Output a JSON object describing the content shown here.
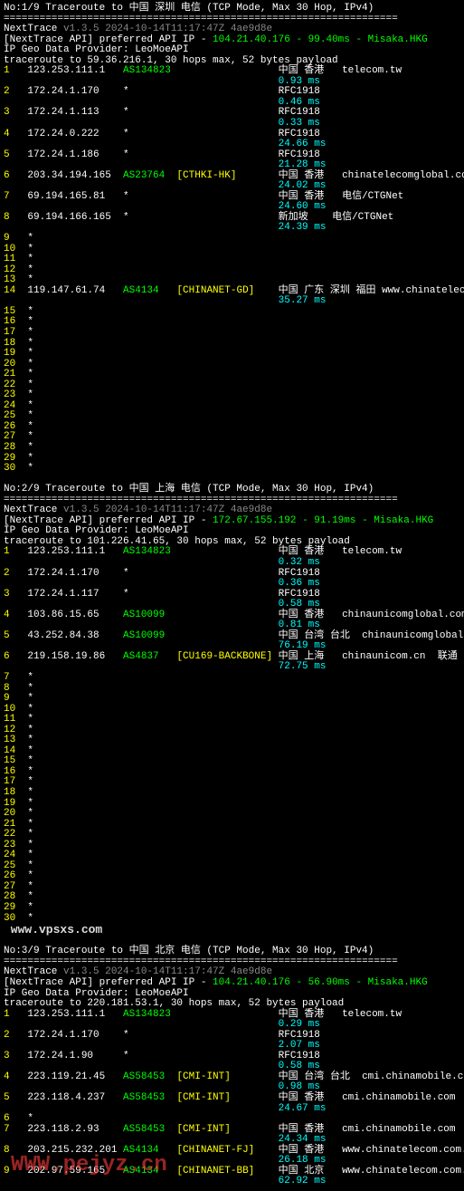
{
  "blocks": [
    {
      "header": "No:1/9 Traceroute to 中国 深圳 电信 (TCP Mode, Max 30 Hop, IPv4)",
      "sep": "==================================================================",
      "ntline": {
        "prefix": "NextTrace ",
        "ver": "v1.3.5 2024-10-14T11:17:47Z 4ae9d8e"
      },
      "apiline": {
        "prefix": "[NextTrace API] preferred API IP - ",
        "ip": "104.21.40.176 - 99.40ms - Misaka.HKG"
      },
      "provider": "IP Geo Data Provider: LeoMoeAPI",
      "traceroute": "traceroute to 59.36.216.1, 30 hops max, 52 bytes payload",
      "hops": [
        {
          "n": "1",
          "ip": "123.253.111.1",
          "as": "AS134823",
          "tag": "",
          "loc": "中国 香港   telecom.tw",
          "ms": "0.93 ms"
        },
        {
          "n": "2",
          "ip": "172.24.1.170",
          "star": "*",
          "loc": "RFC1918",
          "ms": "0.46 ms"
        },
        {
          "n": "3",
          "ip": "172.24.1.113",
          "star": "*",
          "loc": "RFC1918",
          "ms": "0.33 ms"
        },
        {
          "n": "4",
          "ip": "172.24.0.222",
          "star": "*",
          "loc": "RFC1918",
          "ms": "24.66 ms"
        },
        {
          "n": "5",
          "ip": "172.24.1.186",
          "star": "*",
          "loc": "RFC1918",
          "ms": "21.28 ms"
        },
        {
          "n": "6",
          "ip": "203.34.194.165",
          "as": "AS23764",
          "tag": "[CTHKI-HK]",
          "loc": "中国 香港   chinatelecomglobal.com  电信",
          "ms": "24.02 ms"
        },
        {
          "n": "7",
          "ip": "69.194.165.81",
          "star": "*",
          "loc": "中国 香港   电信/CTGNet",
          "ms": "24.60 ms"
        },
        {
          "n": "8",
          "ip": "69.194.166.165",
          "star": "*",
          "loc": "新加坡    电信/CTGNet",
          "ms": "24.39 ms"
        },
        {
          "n": "9",
          "star": "*"
        },
        {
          "n": "10",
          "star": "*"
        },
        {
          "n": "11",
          "star": "*"
        },
        {
          "n": "12",
          "star": "*"
        },
        {
          "n": "13",
          "star": "*"
        },
        {
          "n": "14",
          "ip": "119.147.61.74",
          "as": "AS4134",
          "tag": "[CHINANET-GD]",
          "loc": "中国 广东 深圳 福田 www.chinatelecom.com.cn  电信",
          "ms": "35.27 ms"
        },
        {
          "n": "15",
          "star": "*"
        },
        {
          "n": "16",
          "star": "*"
        },
        {
          "n": "17",
          "star": "*"
        },
        {
          "n": "18",
          "star": "*"
        },
        {
          "n": "19",
          "star": "*"
        },
        {
          "n": "20",
          "star": "*"
        },
        {
          "n": "21",
          "star": "*"
        },
        {
          "n": "22",
          "star": "*"
        },
        {
          "n": "23",
          "star": "*"
        },
        {
          "n": "24",
          "star": "*"
        },
        {
          "n": "25",
          "star": "*"
        },
        {
          "n": "26",
          "star": "*"
        },
        {
          "n": "27",
          "star": "*"
        },
        {
          "n": "28",
          "star": "*"
        },
        {
          "n": "29",
          "star": "*"
        },
        {
          "n": "30",
          "star": "*"
        }
      ]
    },
    {
      "header": "No:2/9 Traceroute to 中国 上海 电信 (TCP Mode, Max 30 Hop, IPv4)",
      "sep": "==================================================================",
      "ntline": {
        "prefix": "NextTrace ",
        "ver": "v1.3.5 2024-10-14T11:17:47Z 4ae9d8e"
      },
      "apiline": {
        "prefix": "[NextTrace API] preferred API IP - ",
        "ip": "172.67.155.192 - 91.19ms - Misaka.HKG"
      },
      "provider": "IP Geo Data Provider: LeoMoeAPI",
      "traceroute": "traceroute to 101.226.41.65, 30 hops max, 52 bytes payload",
      "hops": [
        {
          "n": "1",
          "ip": "123.253.111.1",
          "as": "AS134823",
          "tag": "",
          "loc": "中国 香港   telecom.tw",
          "ms": "0.32 ms"
        },
        {
          "n": "2",
          "ip": "172.24.1.170",
          "star": "*",
          "loc": "RFC1918",
          "ms": "0.36 ms"
        },
        {
          "n": "3",
          "ip": "172.24.1.117",
          "star": "*",
          "loc": "RFC1918",
          "ms": "0.58 ms"
        },
        {
          "n": "4",
          "ip": "103.86.15.65",
          "as": "AS10099",
          "tag": "",
          "loc": "中国 香港   chinaunicomglobal.com",
          "ms": "0.81 ms"
        },
        {
          "n": "5",
          "ip": "43.252.84.38",
          "as": "AS10099",
          "tag": "",
          "loc": "中国 台湾 台北  chinaunicomglobal.com",
          "ms": "76.19 ms"
        },
        {
          "n": "6",
          "ip": "219.158.19.86",
          "as": "AS4837",
          "tag": "[CU169-BACKBONE]",
          "loc": "中国 上海   chinaunicom.cn  联通",
          "ms": "72.75 ms"
        },
        {
          "n": "7",
          "star": "*"
        },
        {
          "n": "8",
          "star": "*"
        },
        {
          "n": "9",
          "star": "*"
        },
        {
          "n": "10",
          "star": "*"
        },
        {
          "n": "11",
          "star": "*"
        },
        {
          "n": "12",
          "star": "*"
        },
        {
          "n": "13",
          "star": "*"
        },
        {
          "n": "14",
          "star": "*"
        },
        {
          "n": "15",
          "star": "*"
        },
        {
          "n": "16",
          "star": "*"
        },
        {
          "n": "17",
          "star": "*"
        },
        {
          "n": "18",
          "star": "*"
        },
        {
          "n": "19",
          "star": "*"
        },
        {
          "n": "20",
          "star": "*"
        },
        {
          "n": "21",
          "star": "*"
        },
        {
          "n": "22",
          "star": "*"
        },
        {
          "n": "23",
          "star": "*"
        },
        {
          "n": "24",
          "star": "*"
        },
        {
          "n": "25",
          "star": "*"
        },
        {
          "n": "26",
          "star": "*"
        },
        {
          "n": "27",
          "star": "*"
        },
        {
          "n": "28",
          "star": "*"
        },
        {
          "n": "29",
          "star": "*"
        },
        {
          "n": "30",
          "star": "*"
        }
      ],
      "footer_wm": " www.vpsxs.com"
    },
    {
      "header": "No:3/9 Traceroute to 中国 北京 电信 (TCP Mode, Max 30 Hop, IPv4)",
      "sep": "==================================================================",
      "ntline": {
        "prefix": "NextTrace ",
        "ver": "v1.3.5 2024-10-14T11:17:47Z 4ae9d8e"
      },
      "apiline": {
        "prefix": "[NextTrace API] preferred API IP - ",
        "ip": "104.21.40.176 - 56.90ms - Misaka.HKG"
      },
      "provider": "IP Geo Data Provider: LeoMoeAPI",
      "traceroute": "traceroute to 220.181.53.1, 30 hops max, 52 bytes payload",
      "hops": [
        {
          "n": "1",
          "ip": "123.253.111.1",
          "as": "AS134823",
          "tag": "",
          "loc": "中国 香港   telecom.tw",
          "ms": "0.29 ms"
        },
        {
          "n": "2",
          "ip": "172.24.1.170",
          "star": "*",
          "loc": "RFC1918",
          "ms": "2.07 ms"
        },
        {
          "n": "3",
          "ip": "172.24.1.90",
          "star": "*",
          "loc": "RFC1918",
          "ms": "0.58 ms"
        },
        {
          "n": "4",
          "ip": "223.119.21.45",
          "as": "AS58453",
          "tag": "[CMI-INT]",
          "loc": "中国 台湾 台北  cmi.chinamobile.com",
          "ms": "0.98 ms"
        },
        {
          "n": "5",
          "ip": "223.118.4.237",
          "as": "AS58453",
          "tag": "[CMI-INT]",
          "loc": "中国 香港   cmi.chinamobile.com  移动",
          "ms": "24.67 ms"
        },
        {
          "n": "6",
          "star": "*"
        },
        {
          "n": "7",
          "ip": "223.118.2.93",
          "as": "AS58453",
          "tag": "[CMI-INT]",
          "loc": "中国 香港   cmi.chinamobile.com  移动",
          "ms": "24.34 ms"
        },
        {
          "n": "8",
          "ip": "203.215.232.201",
          "as": "AS4134",
          "tag": "[CHINANET-FJ]",
          "loc": "中国 香港   www.chinatelecom.com.cn  电信",
          "ms": "26.18 ms"
        },
        {
          "n": "9",
          "ip": "202.97.59.165",
          "as": "AS4134",
          "tag": "[CHINANET-BB]",
          "loc": "中国 北京   www.chinatelecom.com.cn  电信",
          "ms": "62.92 ms"
        }
      ]
    }
  ],
  "watermark_overlay": "WWW.pejyz.cn"
}
